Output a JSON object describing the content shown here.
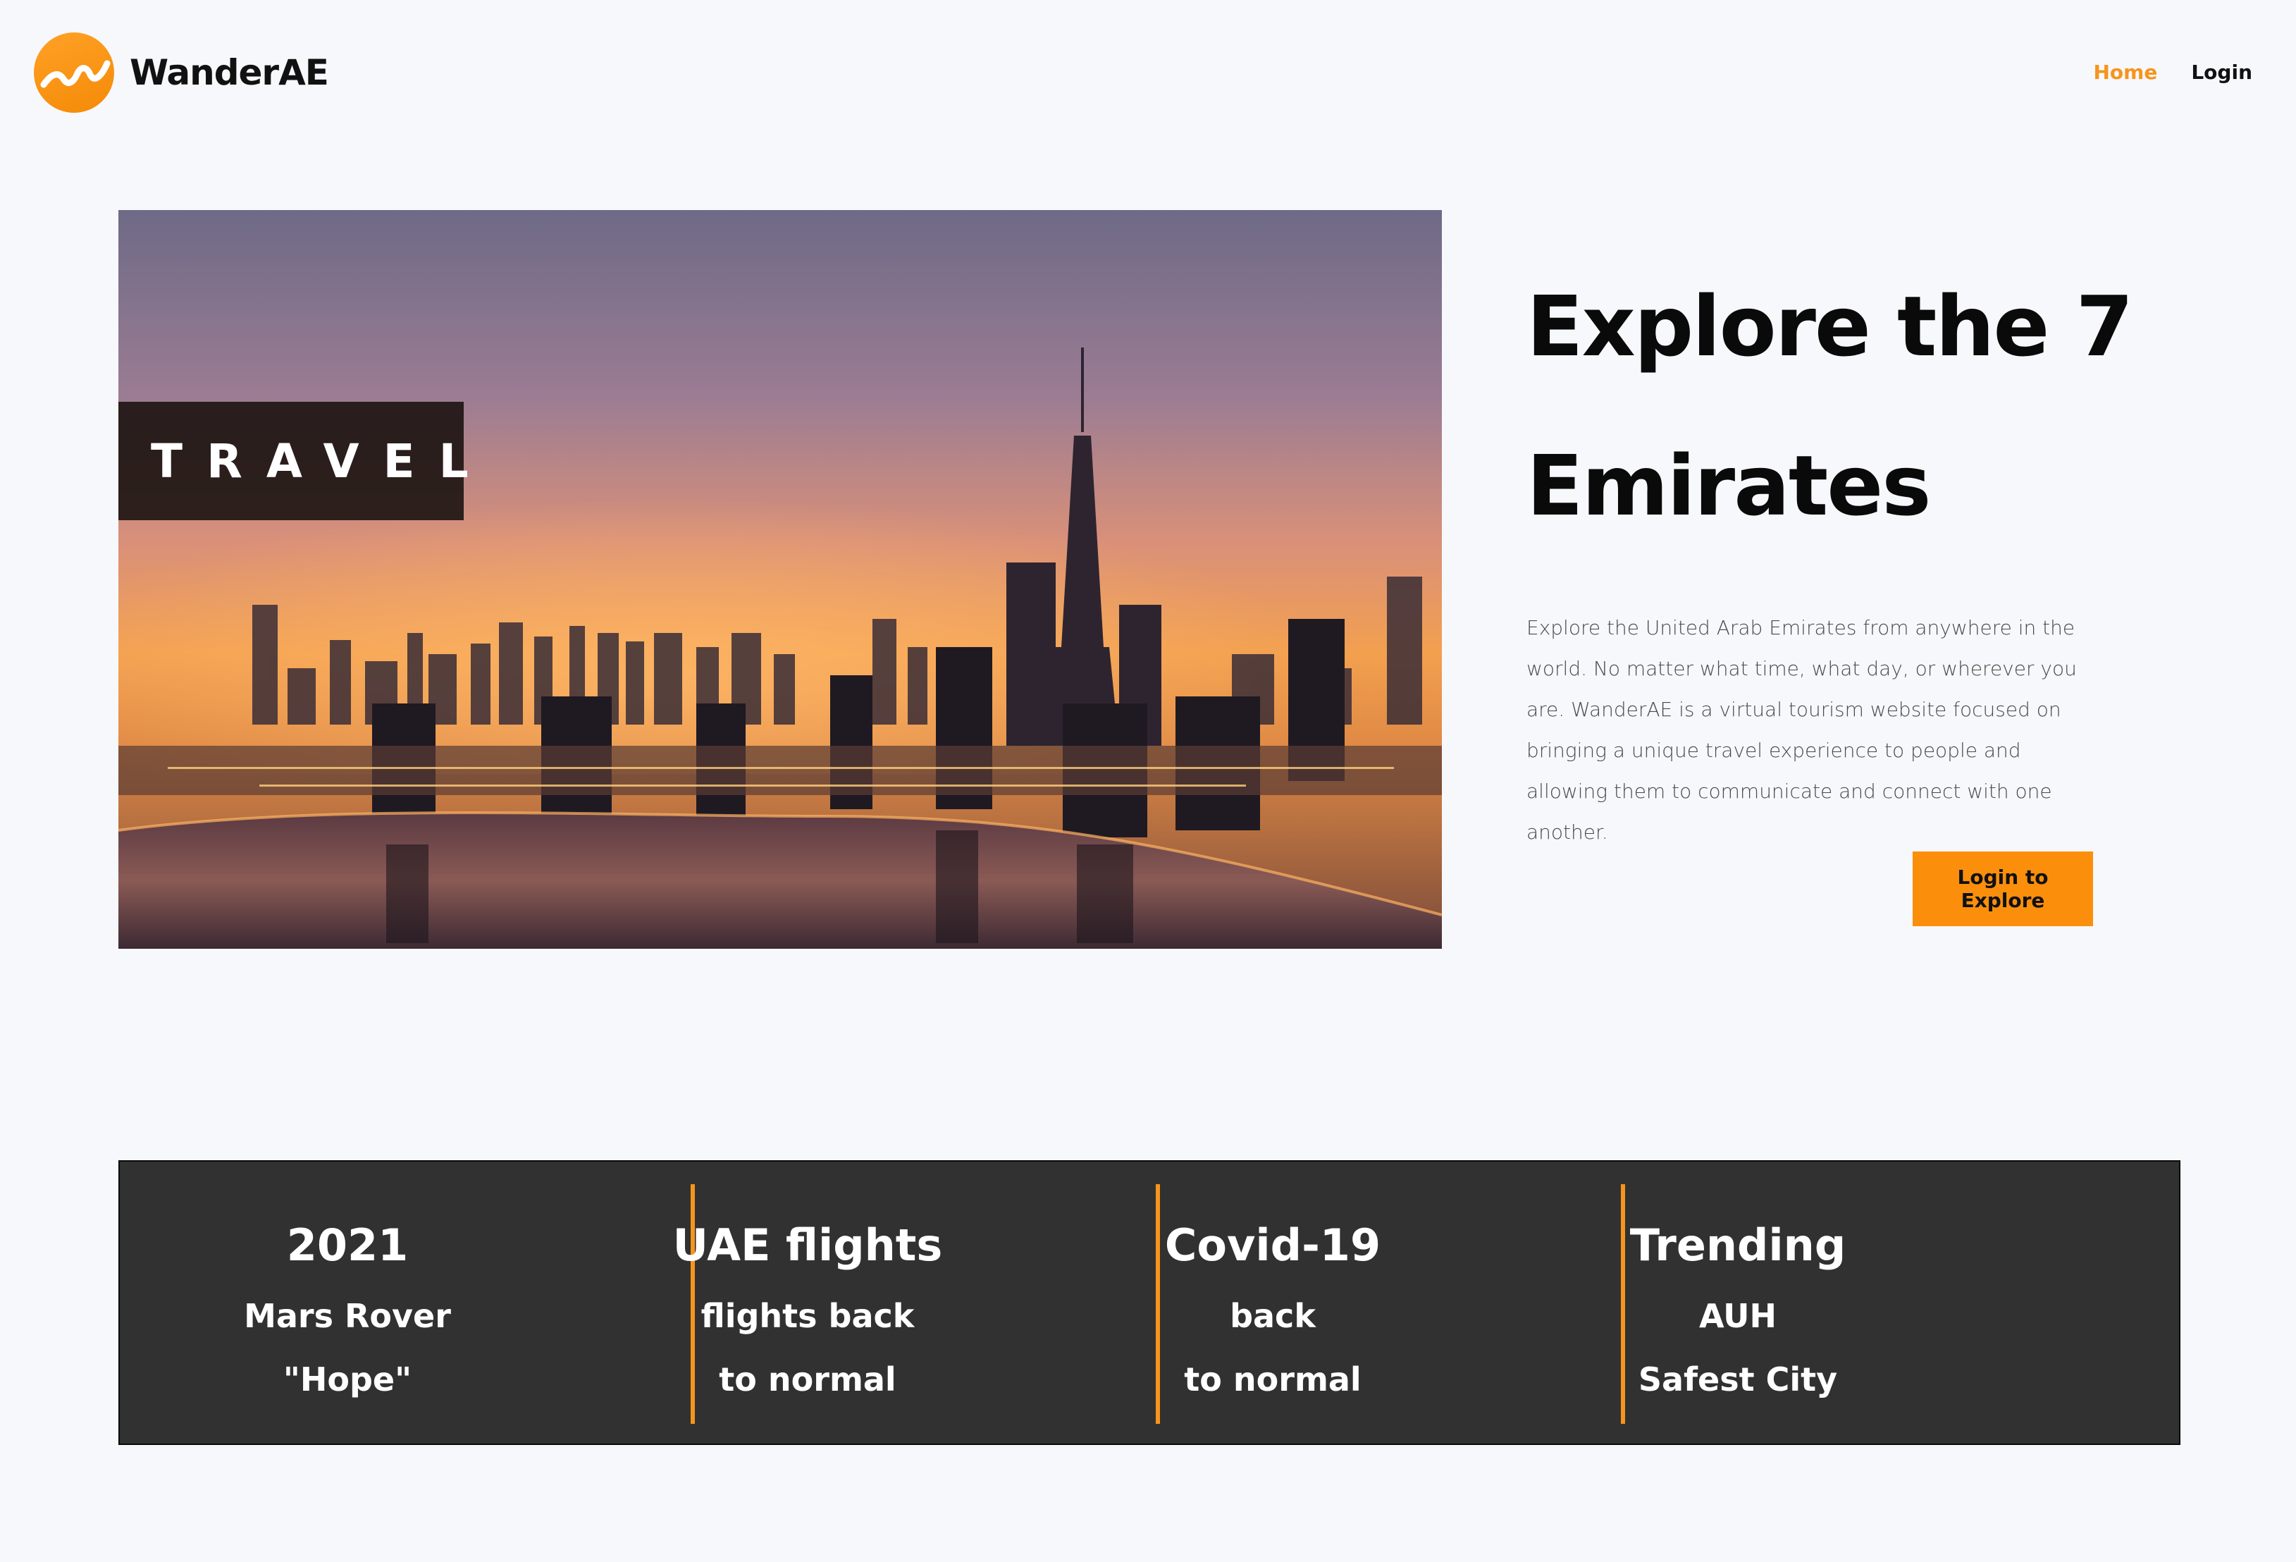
{
  "header": {
    "brand": "WanderAE",
    "nav": [
      {
        "label": "Home",
        "active": true
      },
      {
        "label": "Login",
        "active": false
      }
    ]
  },
  "hero": {
    "badge": "TRAVEL",
    "title_line1": "Explore the 7",
    "title_line2": "Emirates",
    "description": "Explore the United Arab Emirates from anywhere in the world. No matter what time, what day, or wherever you are. WanderAE is a virtual tourism website focused on bringing a unique travel experience to people and allowing them to communicate and connect with one another.",
    "cta": "Login to Explore"
  },
  "stats": [
    {
      "title": "2021",
      "line1": "Mars Rover",
      "line2": "\"Hope\""
    },
    {
      "title": "UAE flights",
      "line1": "flights back",
      "line2": "to normal"
    },
    {
      "title": "Covid-19",
      "line1": "back",
      "line2": "to normal"
    },
    {
      "title": "Trending",
      "line1": "AUH",
      "line2": "Safest City"
    }
  ],
  "colors": {
    "accent": "#f7941d",
    "background": "#f7f8fc",
    "band": "#313131"
  },
  "icons": {
    "logo": "wave-logo-icon"
  }
}
